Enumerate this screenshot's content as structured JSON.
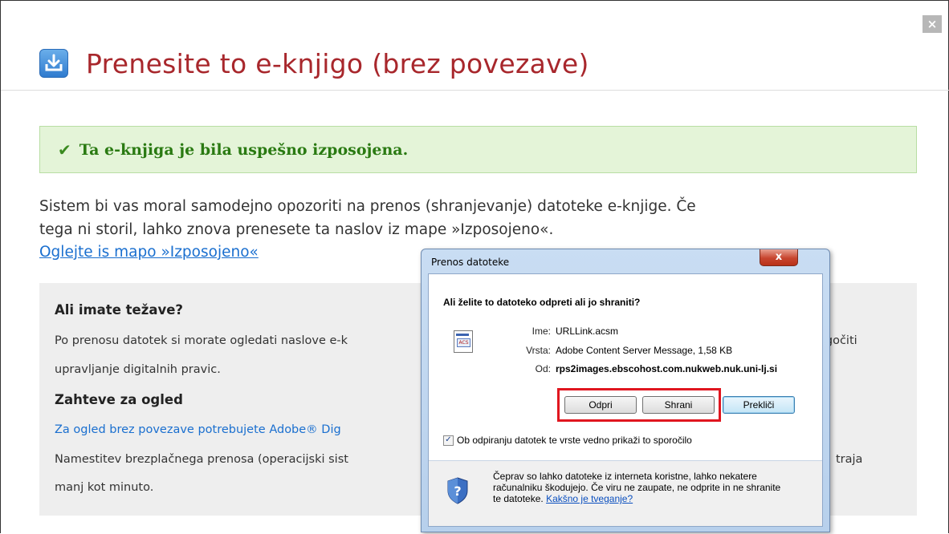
{
  "page": {
    "close_label": "×",
    "title": "Prenesite to e-knjigo (brez povezave)",
    "success": {
      "icon": "checkmark-icon",
      "check": "✔",
      "message": "Ta e-knjiga je bila uspešno izposojena."
    },
    "paragraph_line1": "Sistem bi vas moral samodejno opozoriti na prenos (shranjevanje) datoteke e-knjige. Če",
    "paragraph_line2": "tega ni storil, lahko znova prenesete ta naslov iz mape »Izposojeno«.",
    "folder_link": "Oglejte is mapo »Izposojeno«",
    "help": {
      "heading1": "Ali imate težave?",
      "text1a": "Po prenosu datotek si morate ogledati naslove e-k",
      "text1b": "ogočiti",
      "text2": "upravljanje digitalnih pravic.",
      "heading2": "Zahteve za ogled",
      "link_text": "Za ogled brez povezave potrebujete Adobe® Dig",
      "text3a": "Namestitev brezplačnega prenosa (operacijski sist",
      "text3b": "traja",
      "text4": "manj kot minuto."
    }
  },
  "dialog": {
    "title": "Prenos datoteke",
    "close_label": "x",
    "question": "Ali želite to datoteko odpreti ali jo shraniti?",
    "name_label": "Ime:",
    "name_value": "URLLink.acsm",
    "type_label": "Vrsta:",
    "type_value": "Adobe Content Server Message, 1,58 KB",
    "from_label": "Od:",
    "from_value": "rps2images.ebscohost.com.nukweb.nuk.uni-lj.si",
    "buttons": {
      "open": "Odpri",
      "save": "Shrani",
      "cancel": "Prekliči"
    },
    "checkbox_label": "Ob odpiranju datotek te vrste vedno prikaži to sporočilo",
    "checkbox_checked": true,
    "warning_line1": "Čeprav so lahko datoteke iz interneta koristne, lahko nekatere",
    "warning_line2": "računalniku škodujejo. Če viru ne zaupate, ne odprite in ne shranite",
    "warning_line3": "te datoteke.",
    "risk_link": "Kakšno je tveganje?",
    "colors": {
      "highlight_border": "#e0161f",
      "title_red": "#a8272c",
      "link_blue": "#1a6fcf"
    }
  }
}
